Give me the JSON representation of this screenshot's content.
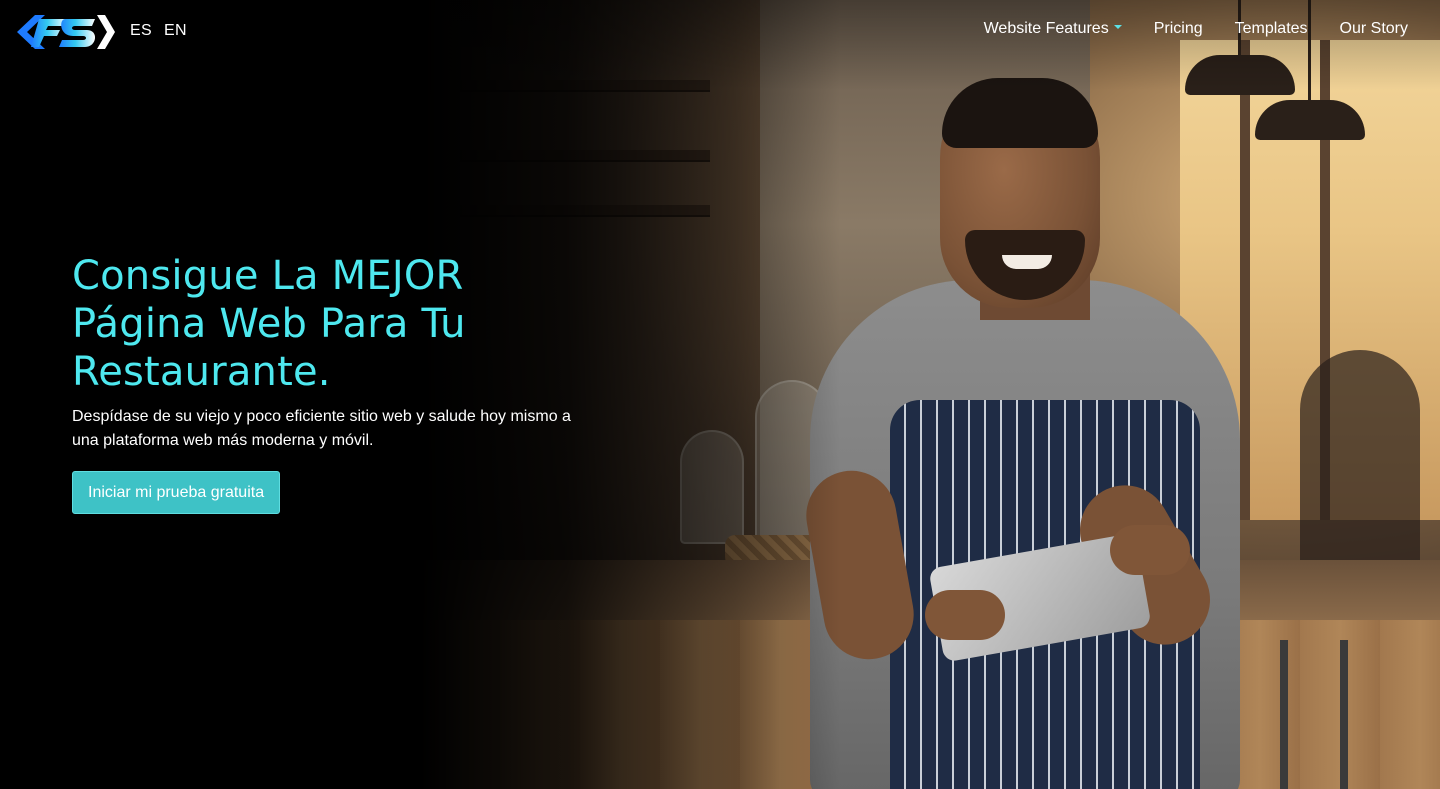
{
  "header": {
    "logo_alt": "FS",
    "languages": [
      "ES",
      "EN"
    ],
    "nav": [
      {
        "label": "Website Features",
        "has_dropdown": true
      },
      {
        "label": "Pricing",
        "has_dropdown": false
      },
      {
        "label": "Templates",
        "has_dropdown": false
      },
      {
        "label": "Our Story",
        "has_dropdown": false
      }
    ]
  },
  "hero": {
    "title": "Consigue La MEJOR Página Web Para Tu Restaurante.",
    "subtitle": "Despídase de su viejo y poco eficiente sitio web y salude hoy mismo a una plataforma web más moderna y móvil.",
    "cta_label": "Iniciar mi prueba gratuita",
    "image_subject": "restaurant-worker-with-tablet-photo"
  },
  "colors": {
    "accent": "#4ee8ef",
    "button": "#3ec2c6",
    "logo_blue": "#1e7bff",
    "background": "#000000",
    "text": "#ffffff"
  }
}
